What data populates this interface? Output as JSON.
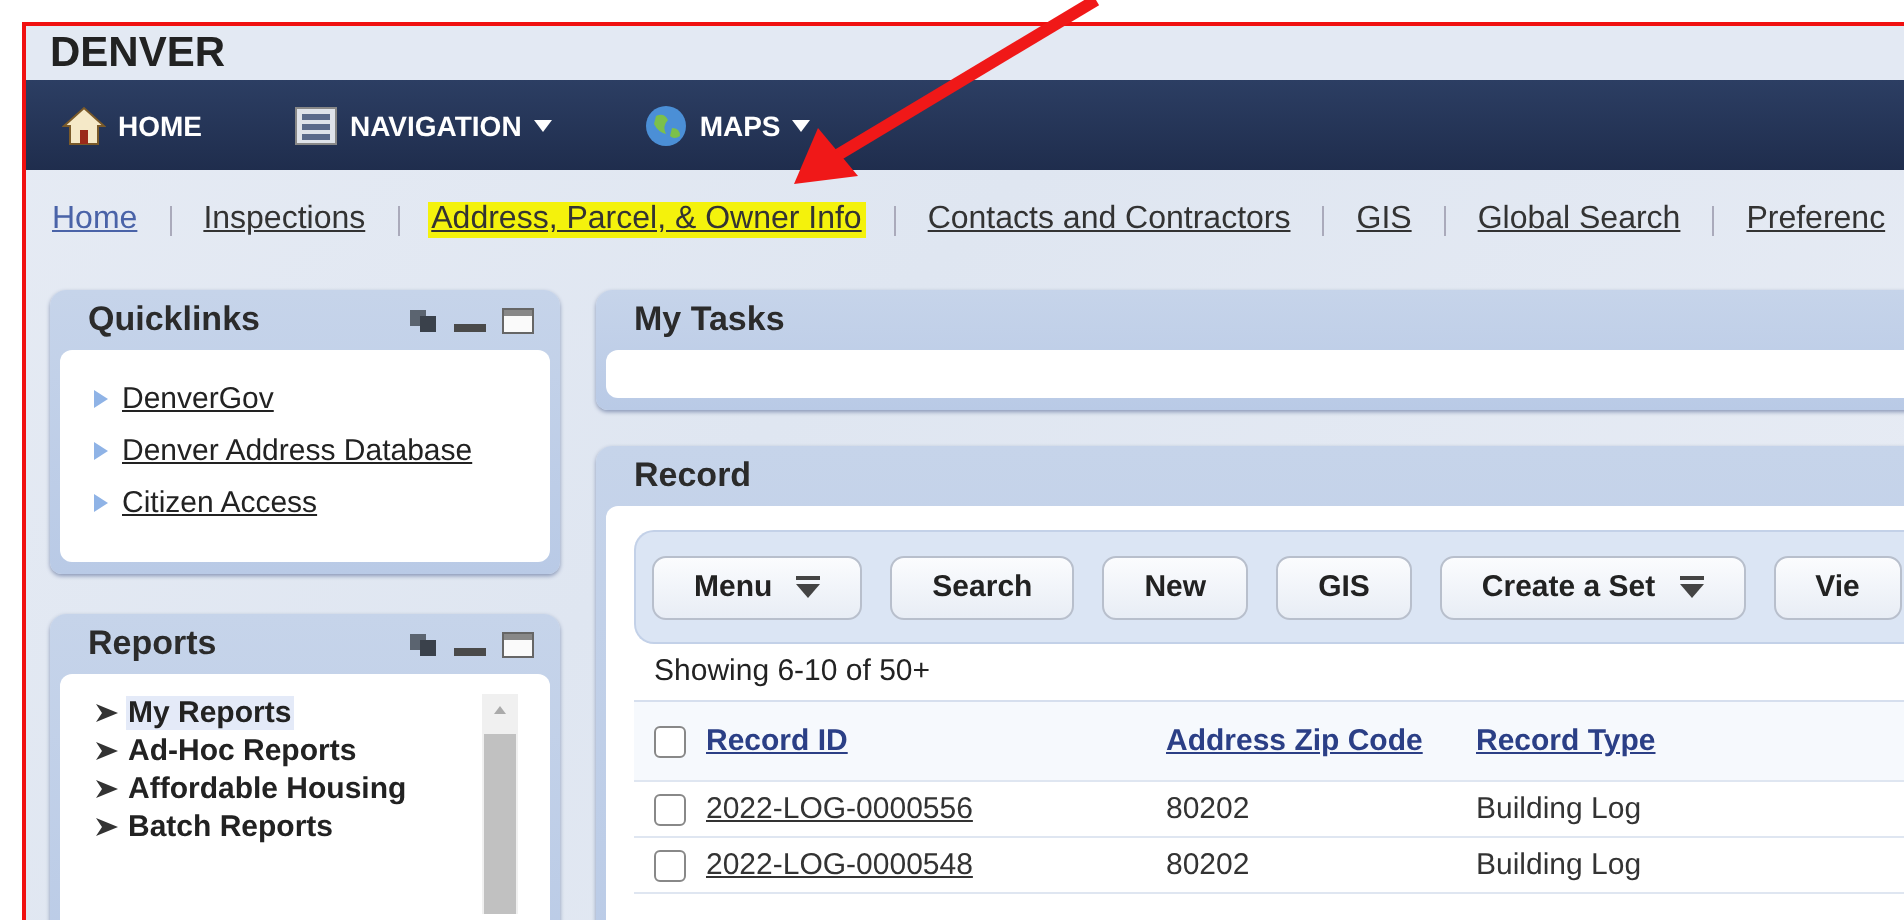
{
  "header": {
    "title": "DENVER"
  },
  "nav": [
    {
      "label": "HOME",
      "kind": "home",
      "dropdown": false
    },
    {
      "label": "NAVIGATION",
      "kind": "navigation",
      "dropdown": true
    },
    {
      "label": "MAPS",
      "kind": "maps",
      "dropdown": true
    }
  ],
  "links": [
    {
      "label": "Home",
      "visited": true,
      "highlighted": false
    },
    {
      "label": "Inspections",
      "visited": false,
      "highlighted": false
    },
    {
      "label": "Address, Parcel, & Owner Info",
      "visited": false,
      "highlighted": true
    },
    {
      "label": "Contacts and Contractors",
      "visited": false,
      "highlighted": false
    },
    {
      "label": "GIS",
      "visited": false,
      "highlighted": false
    },
    {
      "label": "Global Search",
      "visited": false,
      "highlighted": false
    },
    {
      "label": "Preferenc",
      "visited": false,
      "highlighted": false
    }
  ],
  "quicklinks": {
    "title": "Quicklinks",
    "items": [
      "DenverGov",
      "Denver Address Database",
      "Citizen Access"
    ]
  },
  "reports": {
    "title": "Reports",
    "items": [
      {
        "label": "My Reports",
        "selected": true
      },
      {
        "label": "Ad-Hoc Reports",
        "selected": false
      },
      {
        "label": "Affordable Housing",
        "selected": false
      },
      {
        "label": "Batch Reports",
        "selected": false
      }
    ]
  },
  "my_tasks": {
    "title": "My Tasks"
  },
  "record": {
    "title": "Record",
    "buttons": [
      {
        "label": "Menu",
        "dropdown": true
      },
      {
        "label": "Search",
        "dropdown": false
      },
      {
        "label": "New",
        "dropdown": false
      },
      {
        "label": "GIS",
        "dropdown": false
      },
      {
        "label": "Create a Set",
        "dropdown": true
      },
      {
        "label": "Vie",
        "dropdown": false
      }
    ],
    "showing": "Showing 6-10 of 50+",
    "columns": [
      "Record ID",
      "Address Zip Code",
      "Record Type"
    ],
    "header_checked": false,
    "rows": [
      {
        "checked": false,
        "cells": [
          "2022-LOG-0000556",
          "80202",
          "Building Log"
        ]
      },
      {
        "checked": false,
        "cells": [
          "2022-LOG-0000548",
          "80202",
          "Building Log"
        ]
      }
    ]
  },
  "annotation": {
    "kind": "arrow"
  }
}
